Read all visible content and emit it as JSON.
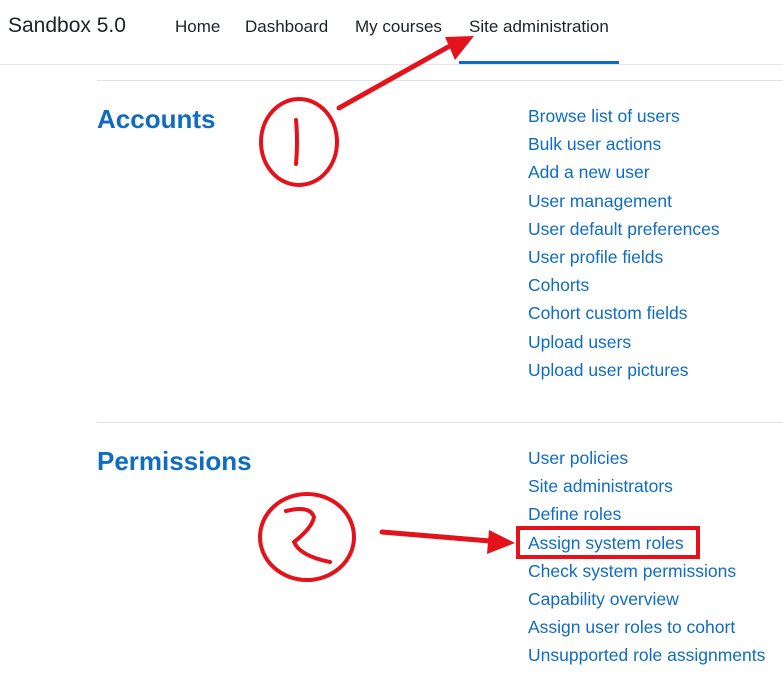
{
  "navbar": {
    "brand": "Sandbox 5.0",
    "items": [
      "Home",
      "Dashboard",
      "My courses",
      "Site administration"
    ],
    "active": "Site administration"
  },
  "sections": [
    {
      "title": "Accounts",
      "links": [
        "Browse list of users",
        "Bulk user actions",
        "Add a new user",
        "User management",
        "User default preferences",
        "User profile fields",
        "Cohorts",
        "Cohort custom fields",
        "Upload users",
        "Upload user pictures"
      ]
    },
    {
      "title": "Permissions",
      "links": [
        "User policies",
        "Site administrators",
        "Define roles",
        "Assign system roles",
        "Check system permissions",
        "Capability overview",
        "Assign user roles to cohort",
        "Unsupported role assignments"
      ]
    }
  ],
  "colors": {
    "link": "#0f6cbf",
    "annotation": "#e3121b"
  },
  "annotations": {
    "highlighted_link": "Assign system roles"
  }
}
